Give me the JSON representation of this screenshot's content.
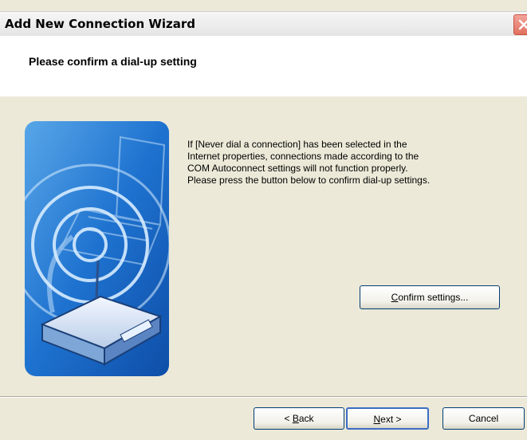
{
  "window": {
    "title": "Add New Connection Wizard"
  },
  "header": {
    "heading": "Please confirm a dial-up setting"
  },
  "body": {
    "description": "If [Never dial a connection] has been selected in the\nInternet properties, connections made according to the\nCOM Autoconnect settings will not function properly.\nPlease press the button below to confirm dial-up settings."
  },
  "confirm_button": {
    "mnemonic": "C",
    "rest": "onfirm settings..."
  },
  "footer": {
    "back": {
      "prefix": "< ",
      "mnemonic": "B",
      "rest": "ack"
    },
    "next": {
      "mnemonic": "N",
      "rest": "ext >"
    },
    "cancel": "Cancel"
  },
  "icons": {
    "close": "close-icon",
    "illustration": "network-router-illustration"
  },
  "colors": {
    "accent": "#1f6fd0",
    "window_bg": "#ece9d8",
    "close": "#e1715f"
  }
}
